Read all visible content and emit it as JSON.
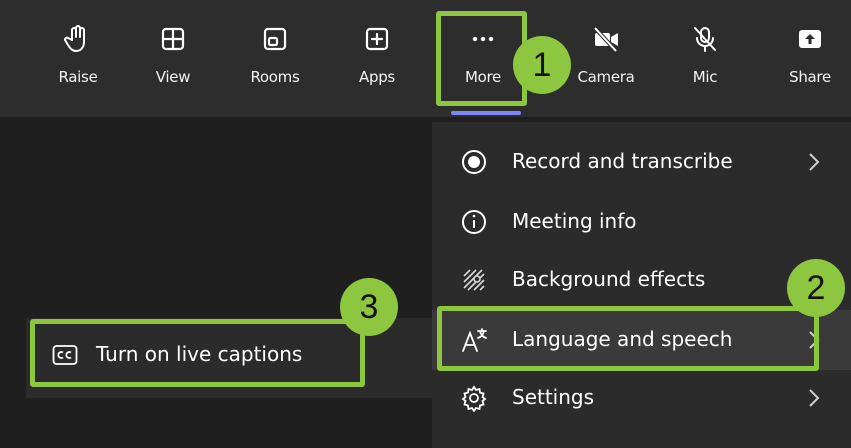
{
  "toolbar": {
    "items": [
      {
        "label": "Raise",
        "icon": "raise-hand-icon"
      },
      {
        "label": "View",
        "icon": "view-grid-icon"
      },
      {
        "label": "Rooms",
        "icon": "rooms-icon"
      },
      {
        "label": "Apps",
        "icon": "apps-add-icon"
      },
      {
        "label": "More",
        "icon": "more-dots-icon"
      },
      {
        "label": "Camera",
        "icon": "camera-off-icon"
      },
      {
        "label": "Mic",
        "icon": "mic-off-icon"
      },
      {
        "label": "Share",
        "icon": "share-icon"
      }
    ]
  },
  "menu": {
    "items": [
      {
        "label": "Record and transcribe",
        "icon": "record-icon"
      },
      {
        "label": "Meeting info",
        "icon": "info-icon"
      },
      {
        "label": "Background effects",
        "icon": "background-effects-icon"
      },
      {
        "label": "Language and speech",
        "icon": "language-speech-icon"
      },
      {
        "label": "Settings",
        "icon": "settings-gear-icon"
      }
    ]
  },
  "submenu": {
    "items": [
      {
        "label": "Turn on live captions",
        "icon": "closed-captions-icon"
      }
    ]
  },
  "annotations": {
    "step1": "1",
    "step2": "2",
    "step3": "3",
    "highlight_color": "#8dc63f"
  },
  "colors": {
    "toolbar_bg": "#2d2d2d",
    "menu_bg": "#2b2b2b",
    "accent_underline": "#7f85f5"
  }
}
